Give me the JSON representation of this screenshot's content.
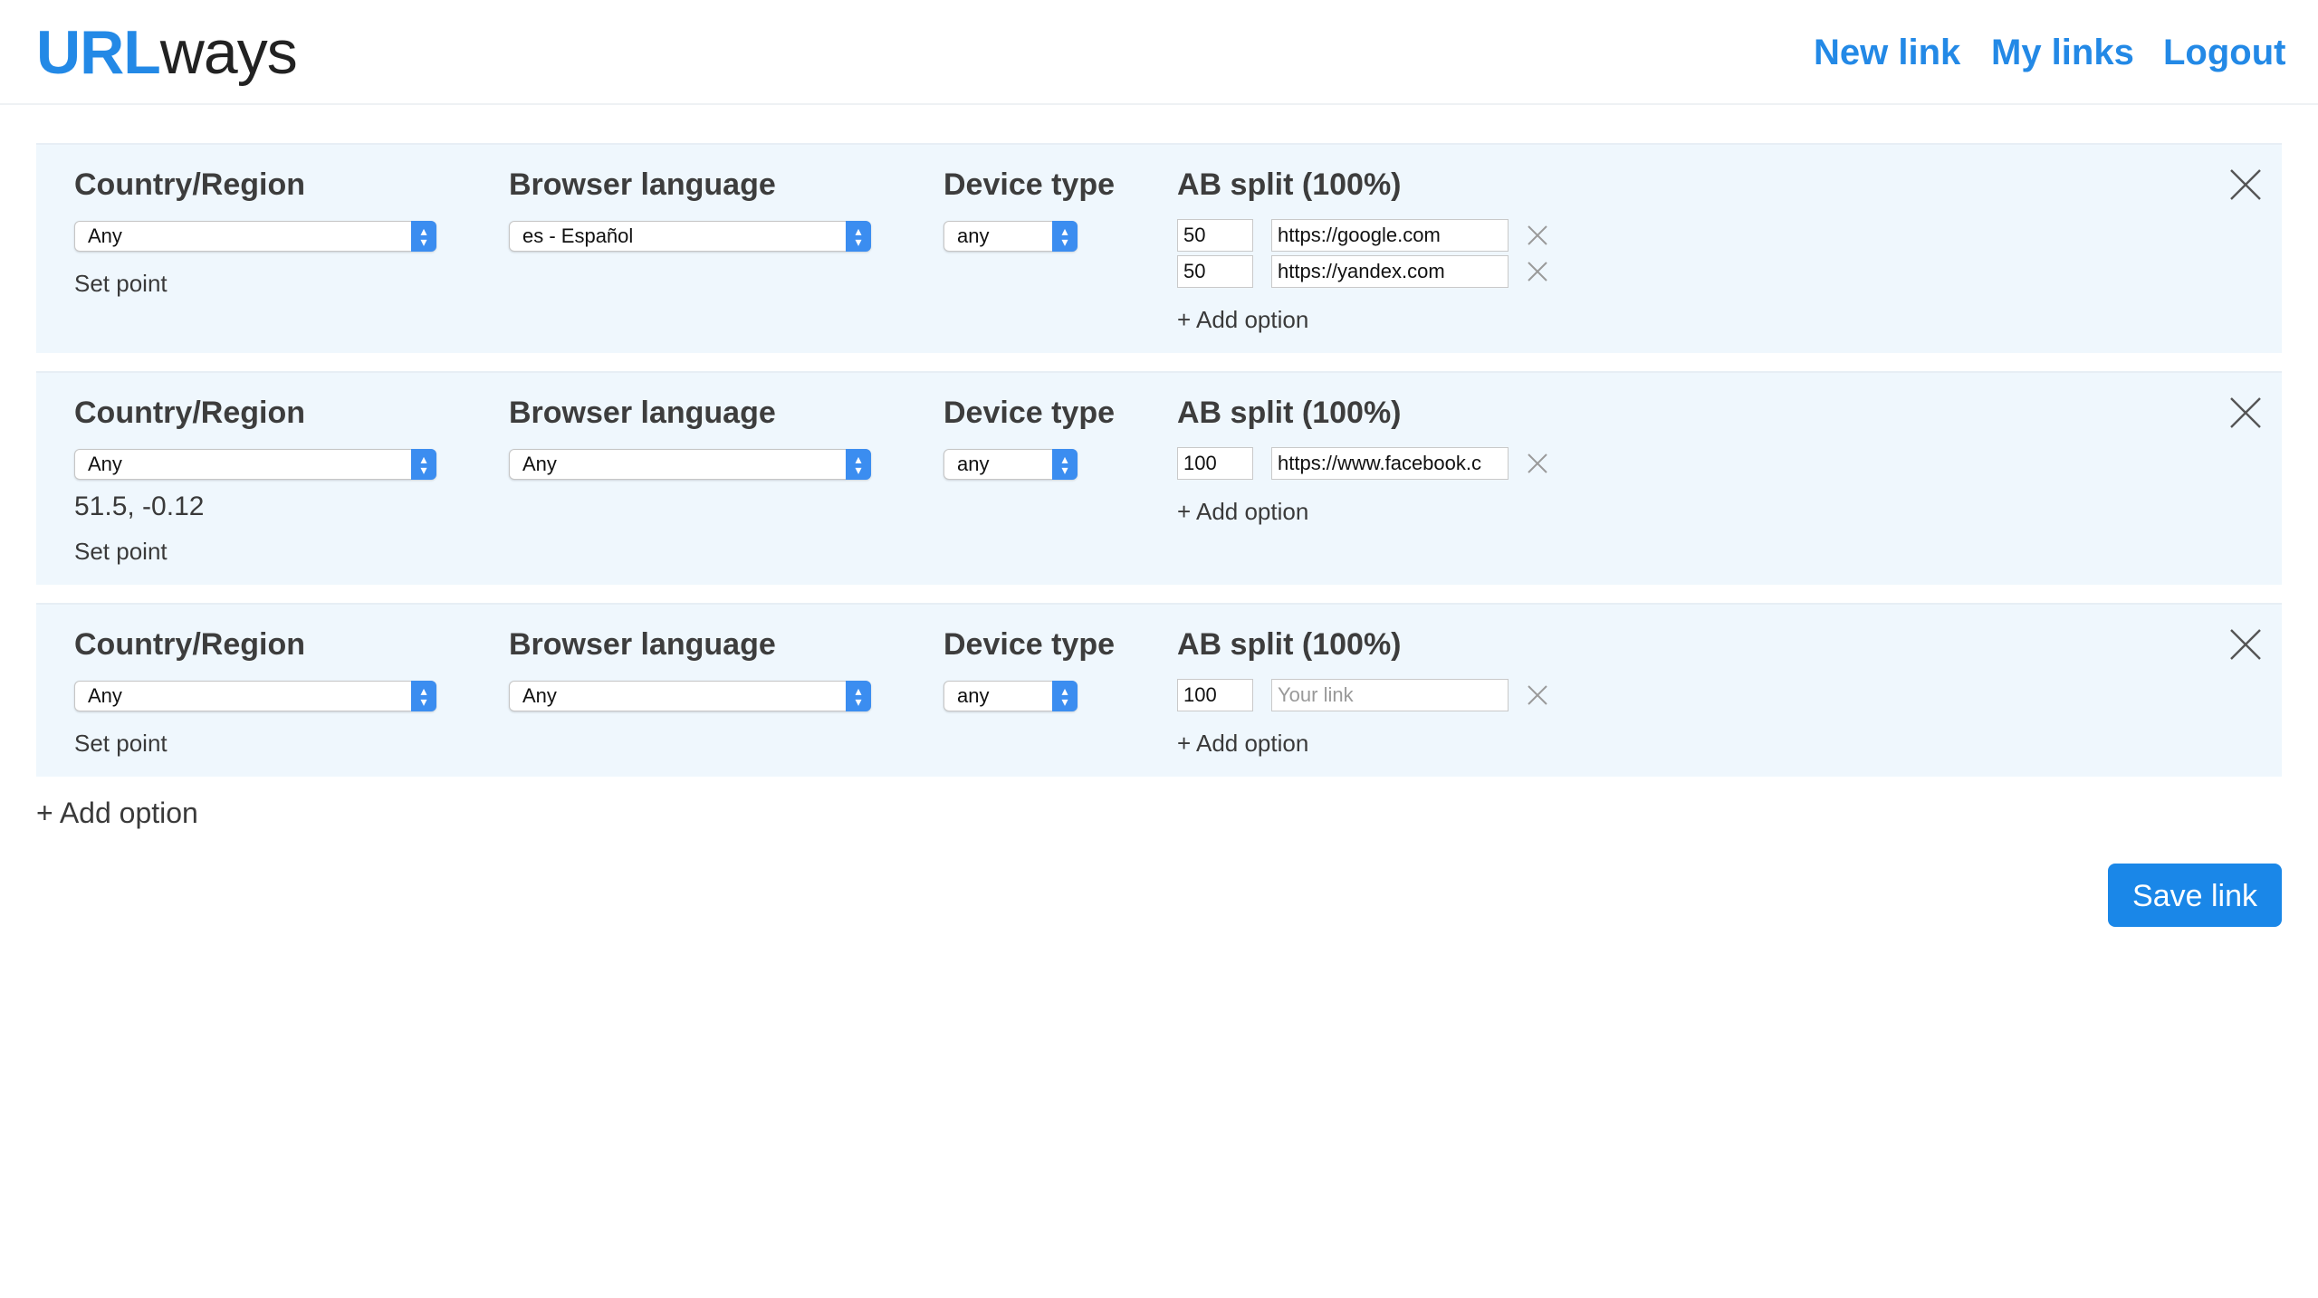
{
  "app": {
    "logo_bold": "URL",
    "logo_light": "ways"
  },
  "nav": {
    "new_link": "New link",
    "my_links": "My links",
    "logout": "Logout"
  },
  "headers": {
    "country": "Country/Region",
    "language": "Browser language",
    "device": "Device type",
    "ab_split": "AB split (100%)"
  },
  "labels": {
    "set_point": "Set point",
    "add_option": "+ Add option",
    "link_placeholder": "Your link"
  },
  "rules": [
    {
      "country": "Any",
      "language": "es - Español",
      "device": "any",
      "coords": "",
      "options": [
        {
          "weight": "50",
          "url": "https://google.com"
        },
        {
          "weight": "50",
          "url": "https://yandex.com"
        }
      ]
    },
    {
      "country": "Any",
      "language": "Any",
      "device": "any",
      "coords": "51.5, -0.12",
      "options": [
        {
          "weight": "100",
          "url": "https://www.facebook.c"
        }
      ]
    },
    {
      "country": "Any",
      "language": "Any",
      "device": "any",
      "coords": "",
      "options": [
        {
          "weight": "100",
          "url": ""
        }
      ]
    }
  ],
  "footer": {
    "add_option": "+ Add option",
    "save": "Save link"
  },
  "colors": {
    "accent": "#1a87e8",
    "card_bg": "#eff7fd"
  }
}
